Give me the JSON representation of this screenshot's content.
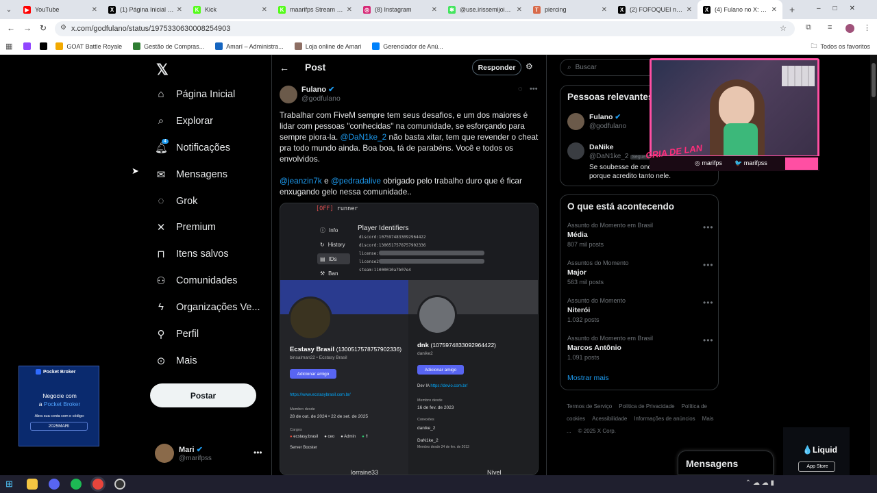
{
  "browser": {
    "tabs": [
      {
        "label": "YouTube",
        "color": "#ff0000",
        "glyph": "▶"
      },
      {
        "label": "(1) Página Inicial / X",
        "color": "#000000",
        "glyph": "X"
      },
      {
        "label": "Kick",
        "color": "#53fc18",
        "glyph": "K"
      },
      {
        "label": "maarifps Stream - Kick",
        "color": "#53fc18",
        "glyph": "K"
      },
      {
        "label": "(8) Instagram",
        "color": "#d62976",
        "glyph": "◎"
      },
      {
        "label": "@use.irissemijoias | Linktree",
        "color": "#43e55e",
        "glyph": "✱"
      },
      {
        "label": "piercing",
        "color": "#d86a4a",
        "glyph": "T"
      },
      {
        "label": "(2) FOFOQUEI no X: \"",
        "color": "#000000",
        "glyph": "X"
      },
      {
        "label": "(4) Fulano no X: \"Traba",
        "color": "#000000",
        "glyph": "X"
      }
    ],
    "url": "x.com/godfulano/status/1975330630008254903",
    "bookmarks": [
      "GOAT Battle Royale",
      "Gestão de Compras...",
      "Amarí – Administra...",
      "Loja online de Amari",
      "Gerenciador de Anú..."
    ],
    "all_favorites": "Todos os favoritos"
  },
  "nav": {
    "items": [
      "Página Inicial",
      "Explorar",
      "Notificações",
      "Mensagens",
      "Grok",
      "Premium",
      "Itens salvos",
      "Comunidades",
      "Organizações Ve...",
      "Perfil",
      "Mais"
    ],
    "notif_badge": "4",
    "post_button": "Postar",
    "account_name": "Mari",
    "account_handle": "@marifpss"
  },
  "ad": {
    "brand": "Pocket Broker",
    "line1": "Negocie com",
    "line2_prefix": "a ",
    "line2_brand": "Pocket Broker",
    "line3": "Abra sua conta com o código:",
    "code": "2025MARI"
  },
  "post": {
    "header": "Post",
    "reply_button": "Responder",
    "author": "Fulano",
    "handle": "@godfulano",
    "p1_a": "Trabalhar com FiveM sempre tem seus desafios, e um dos maiores é lidar com pessoas \"conhecidas\" na comunidade, se esforçando para sempre piora-la. ",
    "p1_mention": "@DaN1ke_2",
    "p1_b": " não basta xitar, tem que revender o cheat pra todo mundo ainda. Boa boa, tá de parabéns. Você e todos os envolvidos.",
    "p2_m1": "@jeanzin7k",
    "p2_and": " e ",
    "p2_m2": "@pedradalive",
    "p2_b": " obrigado pelo trabalho duro que é ficar enxugando gelo nessa comunidade.."
  },
  "screenshot": {
    "status_tag": "[OFF]",
    "status_name": "runner",
    "menu": [
      "Info",
      "History",
      "IDs",
      "Ban"
    ],
    "panel_title": "Player Identifiers",
    "ids": [
      "discord:1075974833092964422",
      "discord:1300517578757902336",
      "license:",
      "license2:",
      "steam:11000010a7b07e4"
    ],
    "left_profile": {
      "name": "Ecstasy Brasil",
      "id": "(1300517578757902336)",
      "sub": "binsalman22 • Ecstasy Brasil",
      "add_friend": "Adicionar amigo",
      "url": "https://www.ecstasybrasil.com.br/",
      "member_label": "Membro desde",
      "member_date": "28 de out. de 2024",
      "member_date2": "22 de set. de 2025",
      "roles_label": "Cargos",
      "roles": [
        "ecstasy.brasil",
        "ceo",
        "Admin",
        "!!"
      ],
      "role_extra": "Server Booster"
    },
    "right_profile": {
      "name": "dnk",
      "id": "(1075974833092964422)",
      "sub": "danike2",
      "add_friend": "Adicionar amigo",
      "dev": "Dev IA",
      "url": "https://devio.com.br/",
      "member_label": "Membro desde",
      "member_date": "16 de fev. de 2023",
      "conn_label": "Conexões",
      "conn1": "danike_2",
      "conn2": "DaN1ke_2",
      "conn2_sub": "Membro desde 24 de fev. de 2013"
    },
    "bottom_name": "lorraine33",
    "bottom_level": "Nível"
  },
  "sidebar": {
    "search_placeholder": "Buscar",
    "relevant_title": "Pessoas relevantes",
    "people": [
      {
        "name": "Fulano",
        "handle": "@godfulano"
      },
      {
        "name": "DaNike",
        "handle": "@DaN1ke_2",
        "follows": "Segue vo",
        "bio": "Se soubesse de onde... entenderia porque acredito tanto nele."
      }
    ],
    "trends_title": "O que está acontecendo",
    "trends": [
      {
        "context": "Assunto do Momento em Brasil",
        "name": "Média",
        "posts": "807 mil posts"
      },
      {
        "context": "Assuntos do Momento",
        "name": "Major",
        "posts": "563 mil posts"
      },
      {
        "context": "Assunto do Momento",
        "name": "Niterói",
        "posts": "1.032 posts"
      },
      {
        "context": "Assunto do Momento em Brasil",
        "name": "Marcos Antônio",
        "posts": "1.091 posts"
      }
    ],
    "show_more": "Mostrar mais",
    "footer": [
      "Termos de Serviço",
      "Política de Privacidade",
      "Política de cookies",
      "Acessibilidade",
      "Informações de anúncios",
      "Mais ...",
      "© 2025 X Corp."
    ],
    "messages": "Mensagens"
  },
  "overlay": {
    "instagram": "marifps",
    "twitter": "marifpss",
    "sign": "CRIA DE LAN"
  },
  "liquid": {
    "brand": "Liquid",
    "store": "App Store"
  },
  "colors": {
    "accent": "#1d9bf0",
    "pink": "#ff4fa3"
  }
}
